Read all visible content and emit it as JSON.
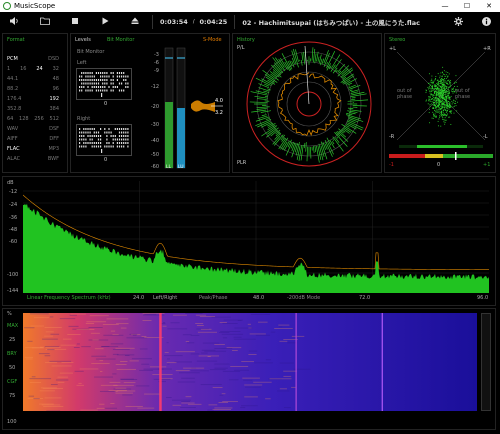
{
  "window": {
    "title": "MusicScope",
    "minimize": "—",
    "maximize": "☐",
    "close": "✕"
  },
  "toolbar": {
    "volume_icon": "🔊",
    "folder_icon": "📂",
    "stop_icon": "■",
    "play_icon": "▶",
    "eject_icon": "⏏",
    "elapsed": "0:03:54",
    "duration": "0:04:25",
    "track": "02 - Hachimitsupai (はちみつぱい) - 土の風にうた.flac",
    "settings_icon": "⚙",
    "info_icon": "ⓘ"
  },
  "format": {
    "title": "Format",
    "rows": [
      [
        "PCM",
        "DSD"
      ],
      [
        "1",
        "16",
        "24",
        "32"
      ],
      [
        "44.1",
        "48"
      ],
      [
        "88.2",
        "96"
      ],
      [
        "176.4",
        "192"
      ],
      [
        "352.8",
        "384"
      ],
      [
        "64",
        "128",
        "256",
        "512"
      ],
      [
        "WAV",
        "DSF"
      ],
      [
        "AIFF",
        "DFF"
      ],
      [
        "FLAC",
        "MP3"
      ],
      [
        "ALAC",
        "BWF"
      ]
    ],
    "highlighted": [
      "PCM",
      "24",
      "192",
      "FLAC"
    ]
  },
  "levels": {
    "title": "Levels",
    "bit_monitor_title": "Bit Monitor",
    "s_mode": "S-Mode",
    "bit_monitor_label": "Bit Monitor",
    "left_label": "Left",
    "right_label": "Right",
    "left_zero": "0",
    "right_zero": "0",
    "scale": [
      "-3",
      "-6",
      "-9",
      "-12",
      "-20",
      "-30",
      "-40",
      "-50",
      "-60"
    ],
    "level_left": 0.55,
    "level_right": 0.5,
    "lr_labels": [
      "LL",
      "LU"
    ],
    "s_value_top": "4.0",
    "s_value_bot": "3.2"
  },
  "history": {
    "title": "History",
    "pl": "P/L",
    "plr": "PLR"
  },
  "stereo": {
    "title": "Stereo",
    "plus_l": "+L",
    "plus_r": "+R",
    "minus_r": "-R",
    "minus_l": "-L",
    "out_phase_left": "out of phase",
    "out_phase_right": "out of phase",
    "corr_min": "-1",
    "corr_mid": "0",
    "corr_max": "+1"
  },
  "spectrum": {
    "db_label": "dB",
    "y_ticks": [
      "-12",
      "-24",
      "-36",
      "-48",
      "-60",
      "-100",
      "-144"
    ],
    "x_ticks": [
      "24.0",
      "48.0",
      "72.0",
      "96.0"
    ],
    "caption": "Linear Frequency Spectrum (kHz)",
    "modes": [
      "Left/Right",
      "Peak/Phase",
      "-200dB Mode"
    ]
  },
  "spectrogram": {
    "pct_label": "%",
    "labels": [
      "MAX",
      "25",
      "BRY",
      "50",
      "CGF",
      "75",
      "100"
    ]
  }
}
